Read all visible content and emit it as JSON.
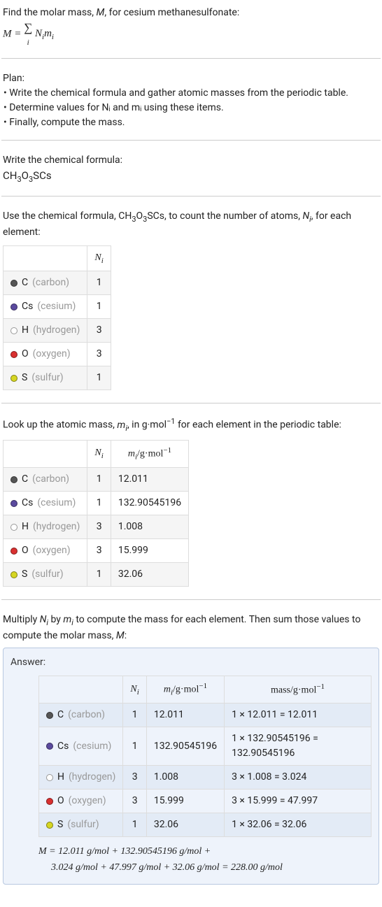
{
  "intro": {
    "line1_prefix": "Find the molar mass, ",
    "line1_var": "M",
    "line1_suffix": ", for cesium methanesulfonate:",
    "eq_lhs": "M",
    "eq_rhs_term": "N",
    "eq_rhs_term2": "m"
  },
  "plan": {
    "heading": "Plan:",
    "items": [
      "Write the chemical formula and gather atomic masses from the periodic table.",
      "Determine values for Nᵢ and mᵢ using these items.",
      "Finally, compute the mass."
    ]
  },
  "step_formula": {
    "heading": "Write the chemical formula:",
    "formula_plain": "CH₃O₃SCs"
  },
  "step_count": {
    "text_pre": "Use the chemical formula, ",
    "text_formula": "CH₃O₃SCs",
    "text_mid": ", to count the number of atoms, ",
    "text_var": "Nᵢ",
    "text_post": ", for each element:",
    "th_n": "Nᵢ"
  },
  "elements": [
    {
      "sym": "C",
      "name": "(carbon)",
      "dot": "#555555",
      "n": 1,
      "m": "12.011",
      "mass": "1 × 12.011 = 12.011"
    },
    {
      "sym": "Cs",
      "name": "(cesium)",
      "dot": "#5b4a9e",
      "n": 1,
      "m": "132.90545196",
      "mass": "1 × 132.90545196 = 132.90545196"
    },
    {
      "sym": "H",
      "name": "(hydrogen)",
      "dot": "#ffffff",
      "n": 3,
      "m": "1.008",
      "mass": "3 × 1.008 = 3.024"
    },
    {
      "sym": "O",
      "name": "(oxygen)",
      "dot": "#d93030",
      "n": 3,
      "m": "15.999",
      "mass": "3 × 15.999 = 47.997"
    },
    {
      "sym": "S",
      "name": "(sulfur)",
      "dot": "#d6d622",
      "n": 1,
      "m": "32.06",
      "mass": "1 × 32.06 = 32.06"
    }
  ],
  "step_mass_lookup": {
    "text_pre": "Look up the atomic mass, ",
    "text_var": "mᵢ",
    "text_mid": ", in g·mol",
    "text_post": " for each element in the periodic table:",
    "th_n": "Nᵢ",
    "th_m_pre": "mᵢ",
    "th_m_unit": "/g·mol"
  },
  "step_compute": {
    "text_l1_a": "Multiply ",
    "text_l1_b": "Nᵢ",
    "text_l1_c": " by ",
    "text_l1_d": "mᵢ",
    "text_l1_e": " to compute the mass for each element. Then sum those values to compute the molar mass, ",
    "text_l1_f": "M",
    "text_l1_g": ":"
  },
  "answer": {
    "label": "Answer:",
    "th_n": "Nᵢ",
    "th_m_pre": "mᵢ",
    "th_m_unit": "/g·mol",
    "th_mass": "mass/g·mol",
    "final_line1": "M = 12.011 g/mol + 132.90545196 g/mol +",
    "final_line2": "3.024 g/mol + 47.997 g/mol + 32.06 g/mol = 228.00 g/mol"
  }
}
